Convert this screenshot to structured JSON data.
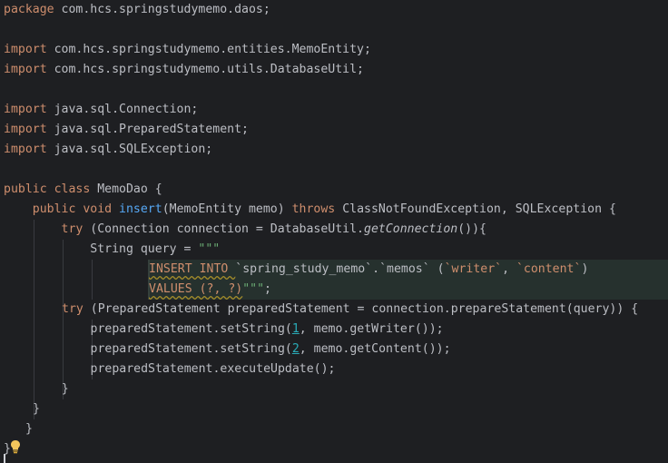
{
  "editor": {
    "lines": [
      {
        "id": "l1",
        "tokens": [
          {
            "t": "package ",
            "c": "kw"
          },
          {
            "t": "com.hcs.springstudymemo.daos;",
            "c": "tx"
          }
        ]
      },
      {
        "id": "l3",
        "tokens": [
          {
            "t": "import ",
            "c": "kw"
          },
          {
            "t": "com.hcs.springstudymemo.entities.MemoEntity;",
            "c": "tx"
          }
        ]
      },
      {
        "id": "l4",
        "tokens": [
          {
            "t": "import ",
            "c": "kw"
          },
          {
            "t": "com.hcs.springstudymemo.utils.DatabaseUtil;",
            "c": "tx"
          }
        ]
      },
      {
        "id": "l6",
        "tokens": [
          {
            "t": "import ",
            "c": "kw"
          },
          {
            "t": "java.sql.Connection;",
            "c": "tx"
          }
        ]
      },
      {
        "id": "l7",
        "tokens": [
          {
            "t": "import ",
            "c": "kw"
          },
          {
            "t": "java.sql.PreparedStatement;",
            "c": "tx"
          }
        ]
      },
      {
        "id": "l8",
        "tokens": [
          {
            "t": "import ",
            "c": "kw"
          },
          {
            "t": "java.sql.SQLException;",
            "c": "tx"
          }
        ]
      },
      {
        "id": "l10",
        "tokens": [
          {
            "t": "public class ",
            "c": "kw"
          },
          {
            "t": "MemoDao {",
            "c": "tx"
          }
        ]
      },
      {
        "id": "l11",
        "tokens": [
          {
            "t": "    ",
            "c": "tx"
          },
          {
            "t": "public void ",
            "c": "kw"
          },
          {
            "t": "insert",
            "c": "fn"
          },
          {
            "t": "(MemoEntity memo) ",
            "c": "tx"
          },
          {
            "t": "throws ",
            "c": "kw"
          },
          {
            "t": "ClassNotFoundException, SQLException {",
            "c": "tx"
          }
        ]
      },
      {
        "id": "l12",
        "tokens": [
          {
            "t": "        ",
            "c": "tx"
          },
          {
            "t": "try ",
            "c": "kw"
          },
          {
            "t": "(Connection connection = DatabaseUtil.",
            "c": "tx"
          },
          {
            "t": "getConnection",
            "c": "fni"
          },
          {
            "t": "()){",
            "c": "tx"
          }
        ]
      },
      {
        "id": "l13",
        "tokens": [
          {
            "t": "            String query = ",
            "c": "tx"
          },
          {
            "t": "\"\"\"",
            "c": "str"
          }
        ]
      },
      {
        "id": "l14",
        "tokens": [
          {
            "t": "INSERT INTO ",
            "c": "sqlkw wavy"
          },
          {
            "t": "`spring_study_memo`",
            "c": "sqlid"
          },
          {
            "t": ".",
            "c": "sqlpunct"
          },
          {
            "t": "`memos`",
            "c": "sqlid"
          },
          {
            "t": " (",
            "c": "sqlpunct"
          },
          {
            "t": "`writer`",
            "c": "sqlbt"
          },
          {
            "t": ", ",
            "c": "sqlpunct"
          },
          {
            "t": "`content`",
            "c": "sqlbt"
          },
          {
            "t": ")",
            "c": "sqlpunct"
          }
        ]
      },
      {
        "id": "l15",
        "tokens": [
          {
            "t": "VALUES (?, ?)",
            "c": "sqlkw wavy"
          },
          {
            "t": "\"\"\"",
            "c": "str"
          },
          {
            "t": ";",
            "c": "tx"
          }
        ]
      },
      {
        "id": "l16",
        "tokens": [
          {
            "t": "        ",
            "c": "tx"
          },
          {
            "t": "try ",
            "c": "kw"
          },
          {
            "t": "(PreparedStatement preparedStatement = connection.prepareStatement(query)) {",
            "c": "tx"
          }
        ]
      },
      {
        "id": "l17",
        "tokens": [
          {
            "t": "            preparedStatement.setString(",
            "c": "tx"
          },
          {
            "t": "1",
            "c": "num"
          },
          {
            "t": ", memo.getWriter());",
            "c": "tx"
          }
        ]
      },
      {
        "id": "l18",
        "tokens": [
          {
            "t": "            preparedStatement.setString(",
            "c": "tx"
          },
          {
            "t": "2",
            "c": "num"
          },
          {
            "t": ", memo.getContent());",
            "c": "tx"
          }
        ]
      },
      {
        "id": "l19",
        "tokens": [
          {
            "t": "            preparedStatement.executeUpdate();",
            "c": "tx"
          }
        ]
      },
      {
        "id": "l20",
        "tokens": [
          {
            "t": "        }",
            "c": "tx"
          }
        ]
      },
      {
        "id": "l21",
        "tokens": [
          {
            "t": "    }",
            "c": "tx"
          }
        ]
      },
      {
        "id": "l22",
        "tokens": [
          {
            "t": "  }",
            "c": "tx"
          }
        ]
      },
      {
        "id": "l23",
        "tokens": [
          {
            "t": "}",
            "c": "tx"
          }
        ]
      }
    ]
  },
  "icons": {
    "intention": "lightbulb-icon"
  },
  "colors": {
    "background": "#1e1f22",
    "keyword": "#cf8e6d",
    "function": "#56a8f5",
    "string": "#6aab73",
    "number": "#2aacb8",
    "text": "#bcbec4",
    "bulb": "#f2c55c"
  }
}
